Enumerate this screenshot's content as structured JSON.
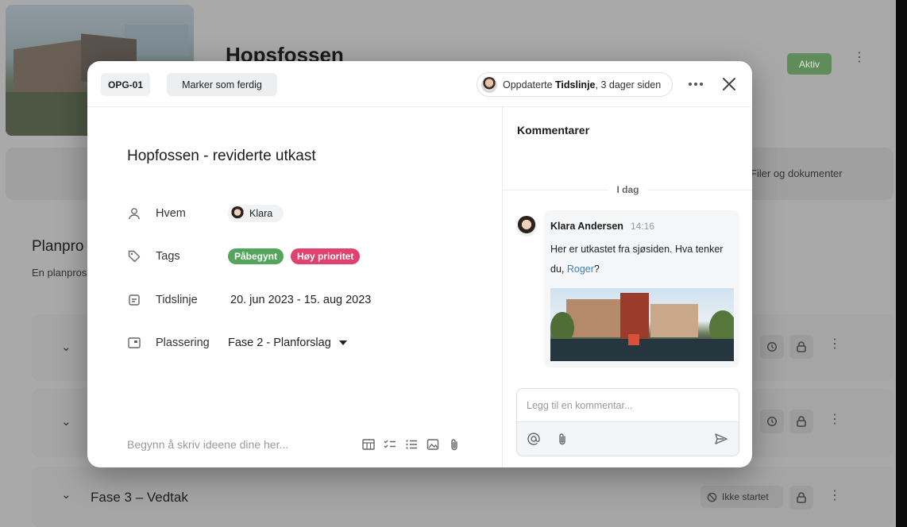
{
  "background": {
    "project_title": "Hopsfossen",
    "status_badge": "Aktiv",
    "files_link": "Filer og dokumenter",
    "section_title": "Planpro",
    "section_subtitle": "En planpros",
    "phase3_title": "Fase 3 – Vedtak",
    "phase3_status": "Ikke startet"
  },
  "modal": {
    "task_id": "OPG-01",
    "mark_done_label": "Marker som ferdig",
    "updated": {
      "prefix": "Oppdaterte ",
      "field": "Tidslinje",
      "suffix": ", 3 dager siden"
    },
    "title": "Hopfossen - reviderte utkast",
    "properties": {
      "who_label": "Hvem",
      "who_value": "Klara",
      "tags_label": "Tags",
      "tags": [
        {
          "label": "Påbegynt",
          "color": "#55a45d"
        },
        {
          "label": "Høy prioritet",
          "color": "#e0416e"
        }
      ],
      "timeline_label": "Tidslinje",
      "timeline_value": "20. jun 2023 - 15. aug 2023",
      "placement_label": "Plassering",
      "placement_value": "Fase 2 - Planforslag"
    },
    "editor_placeholder": "Begynn å skriv ideene dine her...",
    "toolbar_icons": [
      "table-icon",
      "checklist-icon",
      "bullet-list-icon",
      "image-icon",
      "attachment-icon"
    ]
  },
  "comments": {
    "title": "Kommentarer",
    "day_divider": "I dag",
    "items": [
      {
        "author": "Klara Andersen",
        "time": "14:16",
        "text_before": "Her er utkastet fra sjøsiden. Hva tenker du, ",
        "mention": "Roger",
        "text_after": "?"
      }
    ],
    "input_placeholder": "Legg til en kommentar..."
  },
  "colors": {
    "accent_link": "#3a7ec6",
    "tag_green": "#55a45d",
    "tag_pink": "#e0416e"
  }
}
